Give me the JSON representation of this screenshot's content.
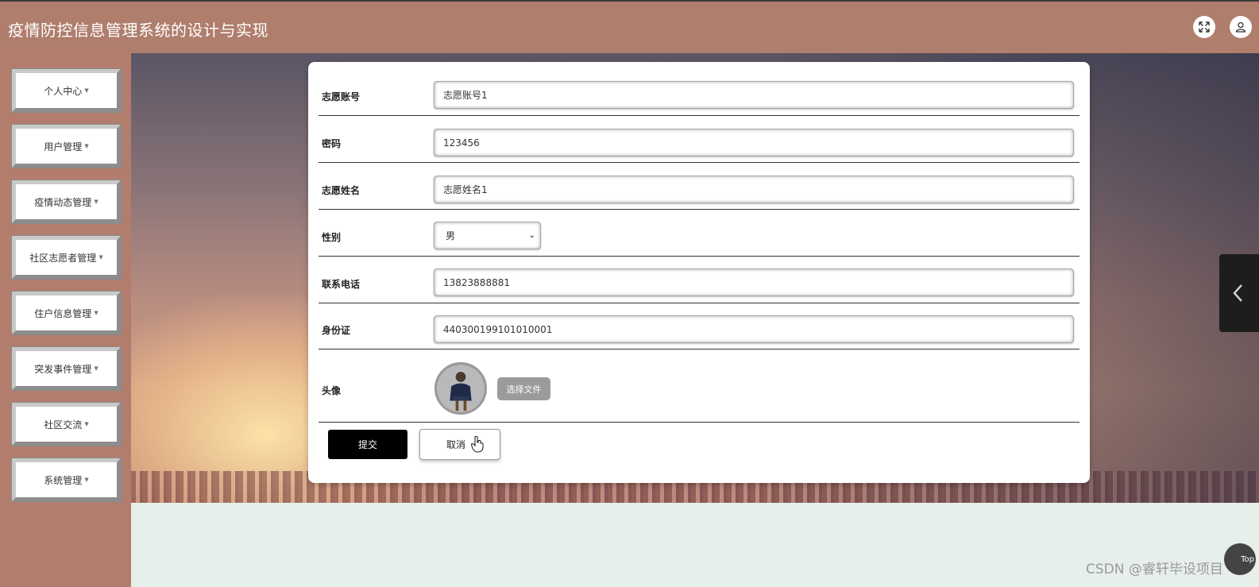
{
  "app": {
    "title": "疫情防控信息管理系统的设计与实现"
  },
  "header": {
    "fullscreen_icon": "fullscreen-icon",
    "user_icon": "user-icon"
  },
  "sidebar": {
    "items": [
      {
        "label": "个人中心"
      },
      {
        "label": "用户管理"
      },
      {
        "label": "疫情动态管理"
      },
      {
        "label": "社区志愿者管理"
      },
      {
        "label": "住户信息管理"
      },
      {
        "label": "突发事件管理"
      },
      {
        "label": "社区交流"
      },
      {
        "label": "系统管理"
      }
    ]
  },
  "form": {
    "account": {
      "label": "志愿账号",
      "value": "志愿账号1"
    },
    "password": {
      "label": "密码",
      "value": "123456"
    },
    "name": {
      "label": "志愿姓名",
      "value": "志愿姓名1"
    },
    "gender": {
      "label": "性别",
      "value": "男"
    },
    "phone": {
      "label": "联系电话",
      "value": "13823888881"
    },
    "id_card": {
      "label": "身份证",
      "value": "440300199101010001"
    },
    "avatar": {
      "label": "头像",
      "choose_file_label": "选择文件"
    },
    "submit_label": "提交",
    "cancel_label": "取消"
  },
  "watermark": "CSDN @睿轩毕设项目",
  "top_button_label": "Top"
}
